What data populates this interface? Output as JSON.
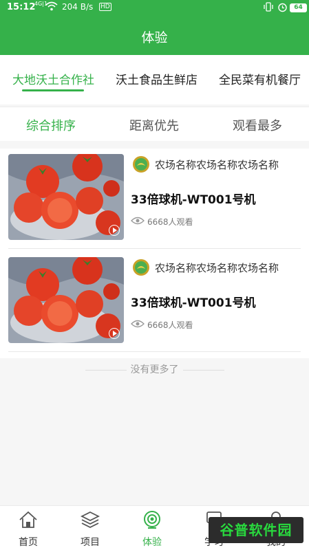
{
  "status_bar": {
    "time": "15:12",
    "signal": "4G|1",
    "speed": "204 B/s",
    "hd": "HD",
    "battery": "64"
  },
  "header": {
    "title": "体验"
  },
  "shop_tabs": [
    {
      "label": "大地沃土合作社",
      "active": true
    },
    {
      "label": "沃土食品生鲜店",
      "active": false
    },
    {
      "label": "全民菜有机餐厅",
      "active": false
    }
  ],
  "sort_tabs": [
    {
      "label": "综合排序",
      "active": true
    },
    {
      "label": "距离优先",
      "active": false
    },
    {
      "label": "观看最多",
      "active": false
    }
  ],
  "items": [
    {
      "farm_name": "农场名称农场名称农场名称",
      "device_name": "33倍球机-WT001号机",
      "views": "6668人观看"
    },
    {
      "farm_name": "农场名称农场名称农场名称",
      "device_name": "33倍球机-WT001号机",
      "views": "6668人观看"
    }
  ],
  "footer_text": "没有更多了",
  "bottom_nav": [
    {
      "label": "首页",
      "icon": "home-icon"
    },
    {
      "label": "项目",
      "icon": "layers-icon"
    },
    {
      "label": "体验",
      "icon": "experience-icon",
      "active": true
    },
    {
      "label": "学习",
      "icon": "study-icon"
    },
    {
      "label": "我的",
      "icon": "profile-icon"
    }
  ],
  "watermark": "谷普软件园",
  "colors": {
    "brand": "#35b14a",
    "tomato": "#e23b22"
  }
}
